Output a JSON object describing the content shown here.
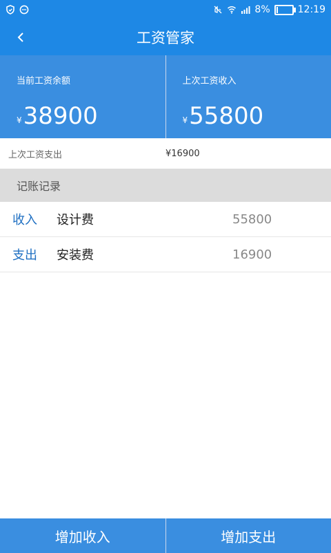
{
  "status_bar": {
    "battery": "8%",
    "time": "12:19"
  },
  "header": {
    "title": "工资管家"
  },
  "summary": {
    "current_balance_label": "当前工资余额",
    "current_balance_currency": "¥",
    "current_balance_value": "38900",
    "last_income_label": "上次工资收入",
    "last_income_currency": "¥",
    "last_income_value": "55800"
  },
  "last_expense": {
    "label": "上次工资支出",
    "value": "¥16900"
  },
  "records": {
    "title": "记账记录",
    "items": [
      {
        "type": "收入",
        "name": "设计费",
        "amount": "55800"
      },
      {
        "type": "支出",
        "name": "安装费",
        "amount": "16900"
      }
    ]
  },
  "actions": {
    "add_income": "增加收入",
    "add_expense": "增加支出"
  },
  "colors": {
    "primary": "#1e88e5",
    "card": "#3a8ee0",
    "link": "#1e6fc2"
  }
}
